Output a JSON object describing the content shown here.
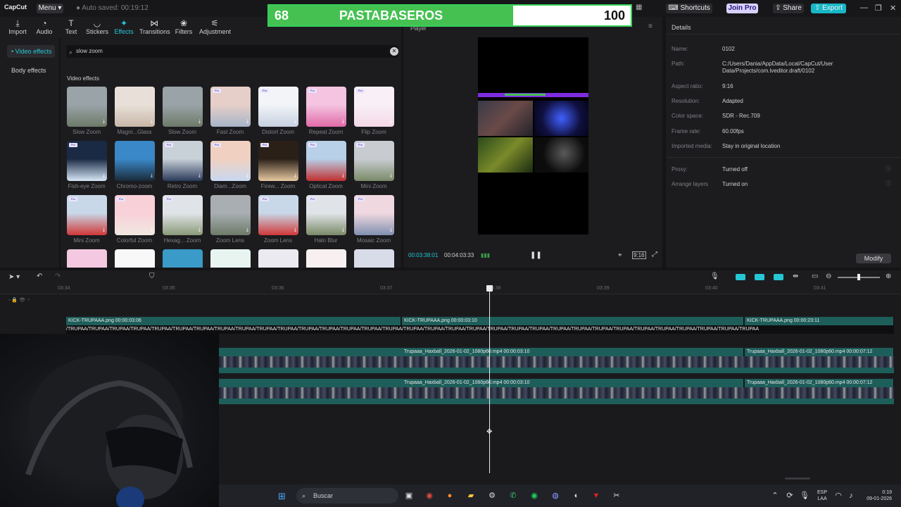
{
  "titlebar": {
    "app_name": "CapCut",
    "menu_label": "Menu",
    "autosave": "Auto saved: 00:19:12",
    "shortcuts": "Shortcuts",
    "join_pro": "Join Pro",
    "share": "Share",
    "export": "Export"
  },
  "scoreboard": {
    "left_score": "68",
    "team": "PASTABASEROS",
    "right_score": "100",
    "fill_fraction": 0.67
  },
  "tabs": [
    {
      "label": "Import",
      "icon": "import-icon"
    },
    {
      "label": "Audio",
      "icon": "audio-icon"
    },
    {
      "label": "Text",
      "icon": "text-icon"
    },
    {
      "label": "Stickers",
      "icon": "stickers-icon"
    },
    {
      "label": "Effects",
      "icon": "effects-icon"
    },
    {
      "label": "Transitions",
      "icon": "transitions-icon"
    },
    {
      "label": "Filters",
      "icon": "filters-icon"
    },
    {
      "label": "Adjustment",
      "icon": "adjustment-icon"
    }
  ],
  "sidebar": {
    "items": [
      "• Video effects",
      "Body effects"
    ]
  },
  "browser": {
    "search_value": "slow zoom",
    "section_title": "Video effects",
    "effects": [
      "Slow Zoom",
      "Magni...Glass",
      "Slow Zoom",
      "Fast Zoom",
      "Distort Zoom",
      "Repeat Zoom",
      "Flip Zoom",
      "Fish-eye Zoom",
      "Chromo-zoom",
      "Retro Zoom",
      "Diam...Zoom",
      "Firew... Zoom",
      "Optical Zoom",
      "Mini Zoom",
      "Mini Zoom",
      "Colorful Zoom",
      "Hexag... Zoom",
      "Zoom Lens",
      "Zoom Lens",
      "Halo Blur",
      "Mosaic Zoom",
      "",
      "",
      "",
      "",
      "",
      "",
      ""
    ]
  },
  "player": {
    "title": "Player",
    "current_time": "00:03:38:01",
    "duration": "00:04:03:33",
    "ratio_label": "9:16"
  },
  "details": {
    "title": "Details",
    "rows": [
      {
        "label": "Name:",
        "value": "0102"
      },
      {
        "label": "Path:",
        "value": "C:/Users/Dania/AppData/Local/CapCut/User Data/Projects/com.lveditor.draft/0102"
      },
      {
        "label": "Aspect ratio:",
        "value": "9:16"
      },
      {
        "label": "Resolution:",
        "value": "Adapted"
      },
      {
        "label": "Color space:",
        "value": "SDR - Rec.709"
      },
      {
        "label": "Frame rate:",
        "value": "60.00fps"
      },
      {
        "label": "Imported media:",
        "value": "Stay in original location"
      },
      {
        "label": "Proxy:",
        "value": "Turned off"
      },
      {
        "label": "Arrange layers",
        "value": "Turned on"
      }
    ],
    "modify": "Modify"
  },
  "timeline": {
    "ticks": [
      "03:34",
      "03:35",
      "03:36",
      "03:37",
      "03:38",
      "03:39",
      "03:40",
      "03:41"
    ],
    "overlay_clips": [
      "KICK-TRUPAAA.png  00:00:03:06",
      "KICK-TRUPAAA.png  00:00:03:10",
      "KICK-TRUPAAA.png  00:00:23:11"
    ],
    "video_clips_row1": [
      "Trupaaa_Haxball_2026-01-02_1080p60.mp4  00:00:03:10",
      "Trupaaa_Haxball_2026-01-02_1080p60.mp4  00:00:07:12"
    ],
    "video_clips_row2": [
      "Trupaaa_Haxball_2026-01-02_1080p60.mp4  00:00:03:10",
      "Trupaaa_Haxball_2026-01-02_1080p60.mp4  00:00:07:12"
    ],
    "text_strip": "/TRUPAA/TRUPAA/TRUPAA/TRUPAA/TRUPAA/TRUPAA/TRUPAA/TRUPAA/TRUPAA/TRUPAA/TRUPAA/TRUPAA/TRUPAA/TRUPAA/TRUPAA/TRUPAA/TRUPAA/TRUPAA/TRUPAA/TRUPAA/TRUPAA/TRUPAA/TRUPAA/TRUPAA/TRUPAA/TRUPAA/TRUPAA/TRUPAA/TRUPAA/TRUPAA/TRUPAA/TRUPAA/TRUPAA"
  },
  "taskbar": {
    "search_placeholder": "Buscar",
    "lang_top": "ESP",
    "lang_bottom": "LAA",
    "time": "0:19",
    "date": "09-01-2026"
  },
  "colors": {
    "accent": "#25c7d4",
    "score_green": "#45c152",
    "clip_teal": "#1e5e5a"
  }
}
